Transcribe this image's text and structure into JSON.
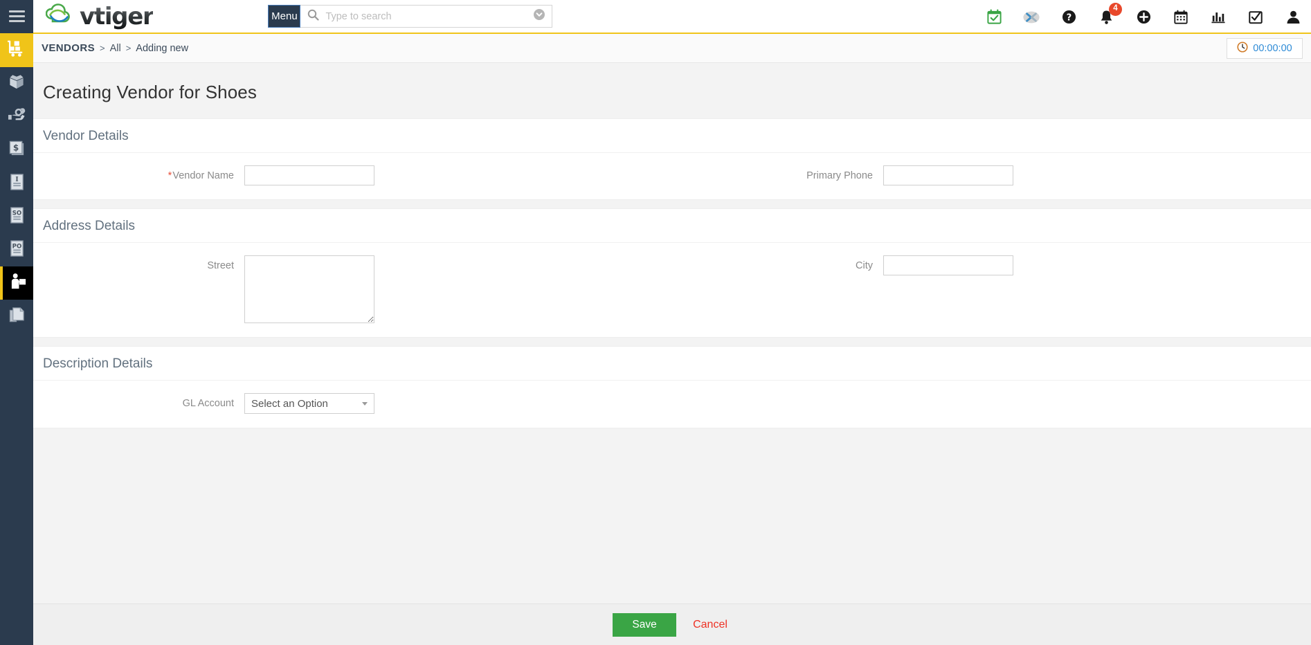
{
  "app": {
    "brand_name": "vtiger",
    "accent_yellow": "#f0c419",
    "sidebar_bg": "#2b3b4e",
    "save_green": "#3aa545",
    "cancel_red": "#ee3124",
    "timer_blue": "#2e8bd6",
    "required_red": "#e8503a"
  },
  "topbar": {
    "hamburger_name": "hamburger-menu",
    "menu_label": "Menu",
    "search": {
      "placeholder": "Type to search",
      "value": ""
    },
    "icons": [
      {
        "name": "calendar-check-icon",
        "label": "Calendar Events",
        "badge": null
      },
      {
        "name": "vtiger-conference-icon",
        "label": "Conference",
        "badge": null
      },
      {
        "name": "help-icon",
        "label": "Help",
        "badge": null
      },
      {
        "name": "notifications-bell-icon",
        "label": "Notifications",
        "badge": "4"
      },
      {
        "name": "quick-create-plus-icon",
        "label": "Quick Create",
        "badge": null
      },
      {
        "name": "calendar-icon",
        "label": "Calendar",
        "badge": null
      },
      {
        "name": "reports-chart-icon",
        "label": "Reports",
        "badge": null
      },
      {
        "name": "todo-checkbox-icon",
        "label": "My Tasks",
        "badge": null
      },
      {
        "name": "user-account-icon",
        "label": "User Account",
        "badge": null
      }
    ]
  },
  "sidebar": {
    "items": [
      {
        "name": "sidebar-item-vendors-cart",
        "icon": "delivery-cart-icon",
        "label": "Inventory",
        "state": "active-yellow"
      },
      {
        "name": "sidebar-item-products",
        "icon": "open-box-icon",
        "label": "Products",
        "state": "normal"
      },
      {
        "name": "sidebar-item-services",
        "icon": "hand-wrench-icon",
        "label": "Services",
        "state": "normal"
      },
      {
        "name": "sidebar-item-price-books",
        "icon": "dollar-document-icon",
        "label": "Price Books",
        "state": "normal"
      },
      {
        "name": "sidebar-item-invoices",
        "icon": "invoice-document-icon",
        "label": "Invoice",
        "state": "normal"
      },
      {
        "name": "sidebar-item-sales-orders",
        "icon": "so-document-icon",
        "label": "Sales Order",
        "state": "normal"
      },
      {
        "name": "sidebar-item-purchase-orders",
        "icon": "po-document-icon",
        "label": "Purchase Order",
        "state": "normal"
      },
      {
        "name": "sidebar-item-vendors",
        "icon": "vendor-person-icon",
        "label": "Vendors",
        "state": "active-black"
      },
      {
        "name": "sidebar-item-documents",
        "icon": "documents-icon",
        "label": "Documents",
        "state": "normal"
      }
    ]
  },
  "breadcrumb": {
    "module": "VENDORS",
    "separator": ">",
    "view": "All",
    "current": "Adding new"
  },
  "timer": {
    "icon": "clock-icon",
    "value": "00:00:00"
  },
  "page": {
    "title": "Creating Vendor for Shoes"
  },
  "blocks": [
    {
      "name": "vendor-details",
      "header": "Vendor Details",
      "fields": [
        {
          "name": "vendor-name",
          "label": "Vendor Name",
          "required": true,
          "type": "text",
          "value": "",
          "placeholder": ""
        },
        {
          "name": "primary-phone",
          "label": "Primary Phone",
          "required": false,
          "type": "text",
          "value": "",
          "placeholder": ""
        }
      ]
    },
    {
      "name": "address-details",
      "header": "Address Details",
      "fields": [
        {
          "name": "street",
          "label": "Street",
          "required": false,
          "type": "textarea",
          "value": "",
          "placeholder": ""
        },
        {
          "name": "city",
          "label": "City",
          "required": false,
          "type": "text",
          "value": "",
          "placeholder": ""
        }
      ]
    },
    {
      "name": "description-details",
      "header": "Description Details",
      "fields": [
        {
          "name": "gl-account",
          "label": "GL Account",
          "required": false,
          "type": "select",
          "value": "Select an Option",
          "placeholder": ""
        }
      ]
    }
  ],
  "footer": {
    "save_label": "Save",
    "cancel_label": "Cancel"
  }
}
